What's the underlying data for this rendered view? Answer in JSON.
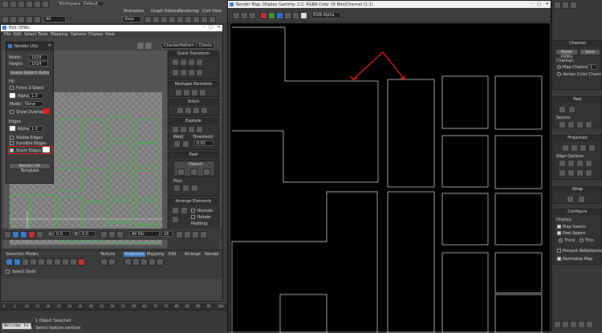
{
  "topbar": {
    "workspace_label": "Workspace: Default",
    "undo_label": "Undo",
    "selection_filter": "All",
    "view_label": "View",
    "menus": [
      "Animation",
      "Graph Editors",
      "Rendering",
      "Civil View"
    ]
  },
  "edit_uvw": {
    "title": "Edit UVWs",
    "menu": [
      "File",
      "Edit",
      "Select",
      "Tools",
      "Mapping",
      "Options",
      "Display",
      "View"
    ],
    "pattern_select": "CheckerPattern  ( Checker )",
    "coords_u": "U:",
    "coords_v": "V:",
    "coord_u_value": "0.0",
    "coord_v_value": "0.0",
    "coord_w_value": "0.0",
    "zoom_value": "16",
    "all_ids": "All IDs",
    "status_value": "0.0",
    "sub_selection": "Selection Modes",
    "element_label": "Select Shell",
    "tabs": [
      "Texture",
      "Projection",
      "Mapping",
      "Edit",
      "Arrange",
      "Render"
    ],
    "right_panel": {
      "quick_transform": "Quick Transform",
      "reshape_elements": "Reshape Elements",
      "stitch": "Stitch",
      "explode": "Explode",
      "weld": "Weld",
      "threshold_label": "Threshold:",
      "threshold_value": "0.01",
      "peel": "Peel",
      "detach": "Detach",
      "pins": "Pins:",
      "arrange_elements": "Arrange Elements",
      "rescale": "Rescale",
      "rotate": "Rotate",
      "padding": "Padding:"
    }
  },
  "render_uvs": {
    "title": "Render UVs",
    "width_label": "Width:",
    "width_value": "1024",
    "height_label": "Height:",
    "height_value": "1024",
    "guess_aspect": "Guess Aspect Ratio",
    "fill_label": "Fill",
    "force_2sided": "Force 2-Sided",
    "alpha_label": "Alpha:",
    "alpha_value": "1.0",
    "mode_label": "Mode:",
    "mode_value": "None",
    "show_overlap": "Show Overlap",
    "edges_label": "Edges",
    "edge_alpha_value": "1.0",
    "visible_edges": "Visible Edges",
    "invisible_edges": "Invisible Edges",
    "seam_edges": "Seam Edges",
    "render_template": "Render UV Template"
  },
  "render_map": {
    "title": "Render Map, Display Gamma: 2.2, RGBA Color 16 Bits/Channel (1:1)",
    "channel_select": "RGB Alpha"
  },
  "right_command_panel": {
    "channel_header": "Channel",
    "reset_uvws": "Reset UVWs",
    "save": "Save",
    "channel_label": "Channel:",
    "map_channel": "Map Channel:",
    "map_channel_value": "1",
    "vertex_color_channel": "Vertex Color Channel",
    "peel_header": "Peel",
    "seams_label": "Seams:",
    "projection_header": "Projection",
    "align_options": "Align Options:",
    "wrap_header": "Wrap",
    "configure_header": "Configure",
    "display_label": "Display:",
    "map_seams": "Map Seams",
    "peel_seams": "Peel Seams",
    "thick": "Thick",
    "thin": "Thin",
    "prevent_reflattening": "Prevent Reflattening",
    "normalize_map": "Normalize Map"
  },
  "timeline": {
    "frame_ticks": [
      "0",
      "5",
      "10",
      "15",
      "20",
      "25",
      "30",
      "35",
      "40",
      "45",
      "50",
      "55",
      "60",
      "65",
      "70",
      "75",
      "80",
      "85",
      "90",
      "95",
      "100"
    ]
  },
  "status_bar": {
    "script_listener": "Welcome to M",
    "selected": "1 Object Selected",
    "prompt": "Select texture vertices"
  },
  "colors": {
    "accent_red": "#e02020",
    "uv_green": "#4caf50",
    "uv_white": "#e8e8e8"
  }
}
